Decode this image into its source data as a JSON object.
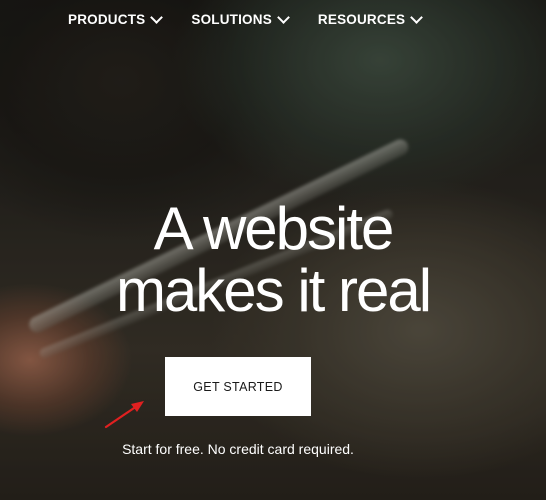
{
  "nav": {
    "items": [
      {
        "label": "PRODUCTS",
        "icon": "chevron-down-icon"
      },
      {
        "label": "SOLUTIONS",
        "icon": "chevron-down-icon"
      },
      {
        "label": "RESOURCES",
        "icon": "chevron-down-icon"
      }
    ]
  },
  "hero": {
    "headline_line1": "A website",
    "headline_line2": "makes it real",
    "cta_label": "GET STARTED",
    "subtext": "Start for free. No credit card required.",
    "background_image": "barber-cutting-hair-photo"
  },
  "annotation": {
    "icon": "red-arrow-icon",
    "color": "#e02020"
  },
  "colors": {
    "text": "#ffffff",
    "button_bg": "#ffffff",
    "button_text": "#1a1a1a"
  }
}
